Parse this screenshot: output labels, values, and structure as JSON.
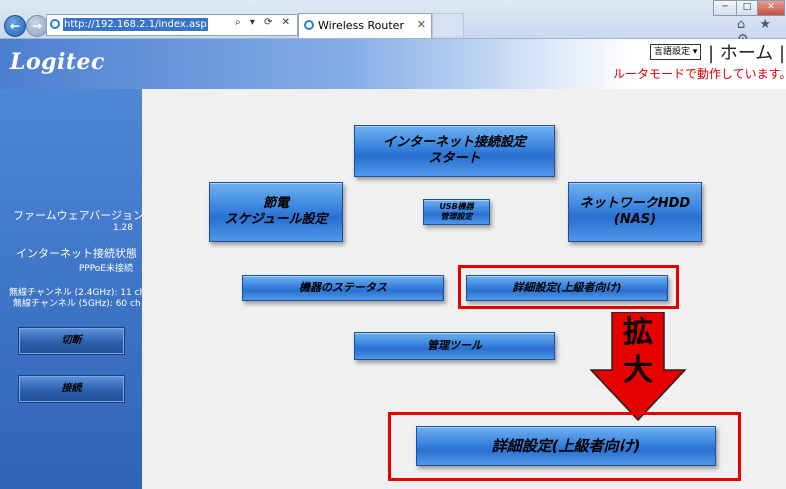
{
  "browser": {
    "back_glyph": "←",
    "forward_glyph": "→",
    "url": "http://192.168.2.1/index.asp",
    "addr_tools": "⌕ ▾ ⟳ ✕",
    "tab_title": "Wireless Router",
    "tab_close": "✕",
    "win_min": "─",
    "win_max": "□",
    "win_close": "✕",
    "icons": "⌂ ★ ⚙"
  },
  "header": {
    "logo": "Logitec",
    "language_select": "言語設定 ▾",
    "home_link": "| ホーム |",
    "mode_status": "ルータモードで動作しています。"
  },
  "sidebar": {
    "firmware_label": "ファームウェアバージョン",
    "firmware_version": "1.28",
    "inet_status_label": "インターネット接続状態",
    "inet_status_value": "PPPoE未接続",
    "channel_24": "無線チャンネル (2.4GHz): 11 ch",
    "channel_5": "無線チャンネル (5GHz): 60 ch",
    "disconnect_button": "切断",
    "connect_button": "接続"
  },
  "main": {
    "internet_setup_start": "インターネット接続設定\nスタート",
    "power_schedule": "節電\nスケジュール設定",
    "usb_settings": "USB機器\n管理設定",
    "network_hdd": "ネットワークHDD\n(NAS)",
    "device_status": "機器のステータス",
    "advanced_settings": "詳細設定(上級者向け)",
    "admin_tools": "管理ツール",
    "enlarge_label_1": "拡",
    "enlarge_label_2": "大",
    "advanced_settings_zoomed": "詳細設定(上級者向け)"
  },
  "colors": {
    "annotation_red": "#e60000",
    "header_blue": "#4d7fd0",
    "button_blue": "#3d88e0"
  }
}
